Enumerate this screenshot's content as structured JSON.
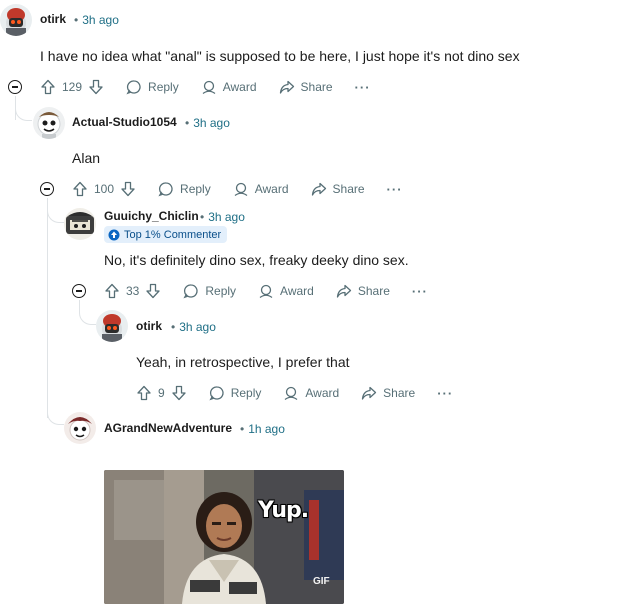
{
  "icons": {
    "upvote": "arrow-up-icon",
    "downvote": "arrow-down-icon",
    "reply": "speech-bubble-icon",
    "award": "award-icon",
    "share": "share-arrow-icon",
    "more": "ellipsis-icon",
    "collapse": "minus-circle-icon"
  },
  "colors": {
    "timestamp": "#1f6f86",
    "meta": "#576f76",
    "badge_bg": "#e3effb",
    "thread_line": "#dfe3e6"
  },
  "actions": {
    "reply": "Reply",
    "award": "Award",
    "share": "Share",
    "more": "···"
  },
  "comments": [
    {
      "username": "otirk",
      "dot": "•",
      "time": "3h ago",
      "text": "I have no idea what \"anal\" is supposed to be here, I just hope it's not dino sex",
      "score": "129"
    },
    {
      "username": "Actual-Studio1054",
      "dot": "•",
      "time": "3h ago",
      "text": "Alan",
      "score": "100"
    },
    {
      "username": "Guuichy_Chiclin",
      "dot": "•",
      "time": "3h ago",
      "badge": "Top 1% Commenter",
      "text": "No, it's definitely dino sex, freaky deeky dino sex.",
      "score": "33"
    },
    {
      "username": "otirk",
      "dot": "•",
      "time": "3h ago",
      "text": "Yeah, in retrospective, I prefer that",
      "score": "9"
    },
    {
      "username": "AGrandNewAdventure",
      "dot": "•",
      "time": "1h ago",
      "gif_caption": "Yup.",
      "gif_label": "GIF"
    }
  ]
}
